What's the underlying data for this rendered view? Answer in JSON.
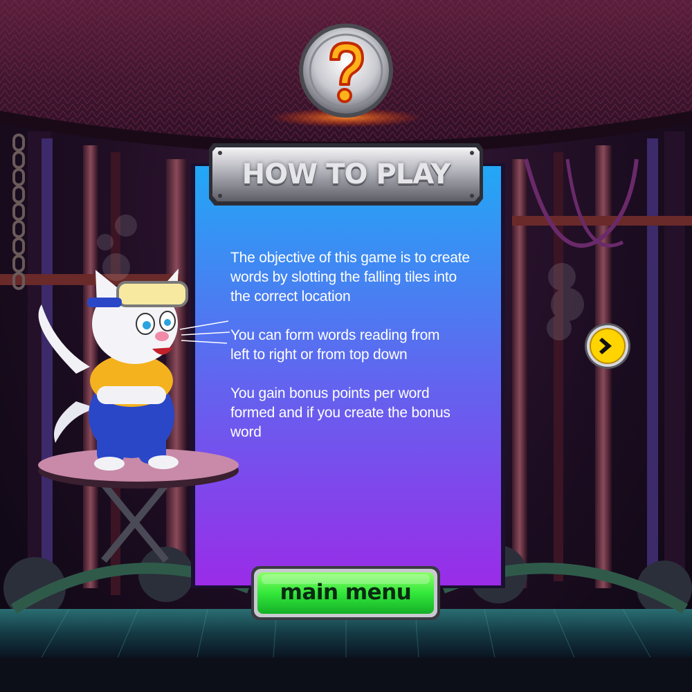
{
  "screen": "how-to-play",
  "title": "HOW TO PLAY",
  "instructions": [
    {
      "line1": "The objective of this game is to create",
      "line2": "words by slotting the falling tiles into",
      "line3": "the correct location"
    },
    {
      "line1": "You can form words reading from",
      "line2": "left to right or from top down"
    },
    {
      "line1": "You gain bonus points per word",
      "line2": "formed and if you create the bonus",
      "line3": "word"
    }
  ],
  "main_menu_button": {
    "label": "main menu"
  },
  "next_button": {
    "icon": "chevron-right-icon"
  },
  "help_badge": {
    "icon": "question-mark-icon"
  },
  "colors": {
    "panel_top": "#2aa4f4",
    "panel_bottom": "#8a2be2",
    "button_green": "#39f23a",
    "next_yellow": "#ffd400",
    "question_orange": "#ff7a00"
  }
}
